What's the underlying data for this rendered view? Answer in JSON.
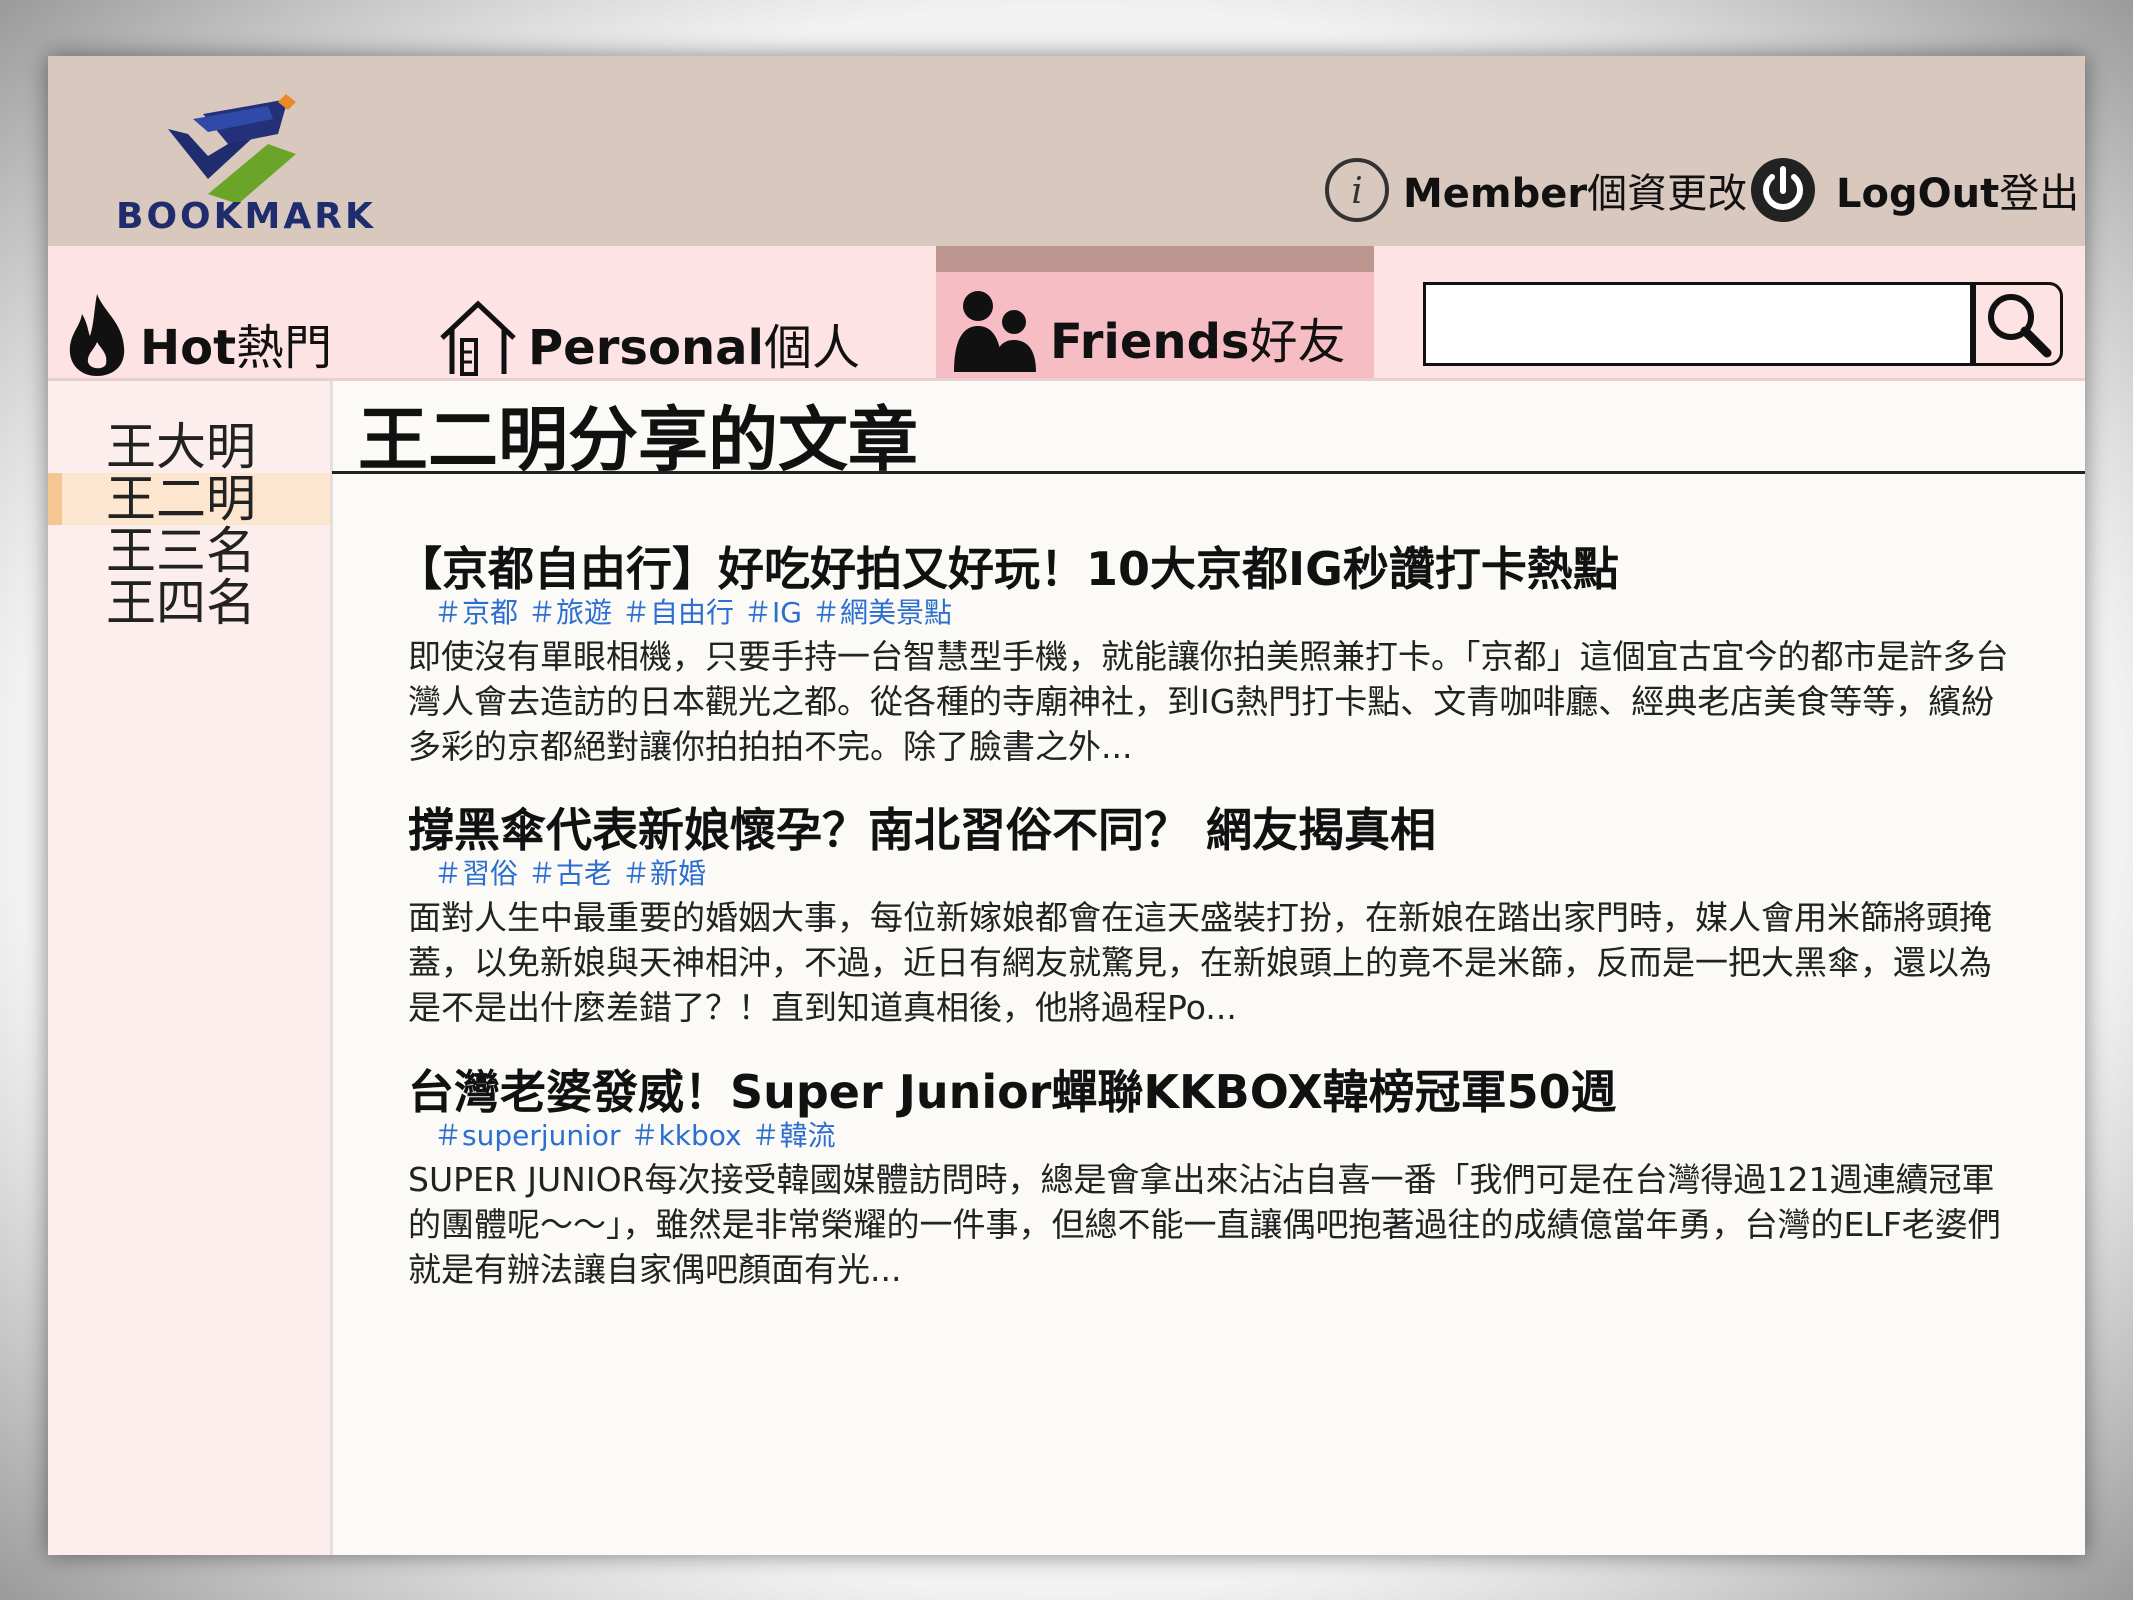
{
  "header": {
    "logo_text": "BOOKMARK",
    "member_en": "Member",
    "member_zh": "個資更改",
    "logout_en": "LogOut",
    "logout_zh": "登出"
  },
  "nav": {
    "tabs": [
      {
        "en": "Hot",
        "zh": "熱門",
        "icon": "flame-icon"
      },
      {
        "en": "Personal",
        "zh": "個人",
        "icon": "house-icon"
      },
      {
        "en": "Friends",
        "zh": "好友",
        "icon": "people-icon",
        "active": true
      }
    ],
    "search": {
      "value": "",
      "icon": "search-icon"
    }
  },
  "sidebar": {
    "items": [
      {
        "label": "王大明"
      },
      {
        "label": "王二明",
        "selected": true
      },
      {
        "label": "王三名"
      },
      {
        "label": "王四名"
      }
    ]
  },
  "main": {
    "title": "王二明分享的文章",
    "articles": [
      {
        "title": "【京都自由行】好吃好拍又好玩！10大京都IG秒讚打卡熱點",
        "tags": [
          "＃京都",
          "＃旅遊",
          "＃自由行",
          "＃IG",
          "＃網美景點"
        ],
        "body": "即使沒有單眼相機，只要手持一台智慧型手機，就能讓你拍美照兼打卡。「京都」這個宜古宜今的都市是許多台灣人會去造訪的日本觀光之都。從各種的寺廟神社，到IG熱門打卡點、文青咖啡廳、經典老店美食等等，繽紛多彩的京都絕對讓你拍拍拍不完。除了臉書之外..."
      },
      {
        "title": "撐黑傘代表新娘懷孕？南北習俗不同？ 網友揭真相",
        "tags": [
          "＃習俗",
          "＃古老",
          "＃新婚"
        ],
        "body": "面對人生中最重要的婚姻大事，每位新嫁娘都會在這天盛裝打扮，在新娘在踏出家門時，媒人會用米篩將頭掩蓋，以免新娘與天神相沖，不過，近日有網友就驚見，在新娘頭上的竟不是米篩，反而是一把大黑傘，還以為是不是出什麼差錯了？！直到知道真相後，他將過程Po..."
      },
      {
        "title": "台灣老婆發威！Super Junior蟬聯KKBOX韓榜冠軍50週",
        "tags": [
          "＃superjunior",
          "＃kkbox",
          "＃韓流"
        ],
        "body": "SUPER JUNIOR每次接受韓國媒體訪問時，總是會拿出來沾沾自喜一番「我們可是在台灣得過121週連續冠軍的團體呢～～」，雖然是非常榮耀的一件事，但總不能一直讓偶吧抱著過往的成績億當年勇，台灣的ELF老婆們就是有辦法讓自家偶吧顏面有光..."
      }
    ]
  }
}
